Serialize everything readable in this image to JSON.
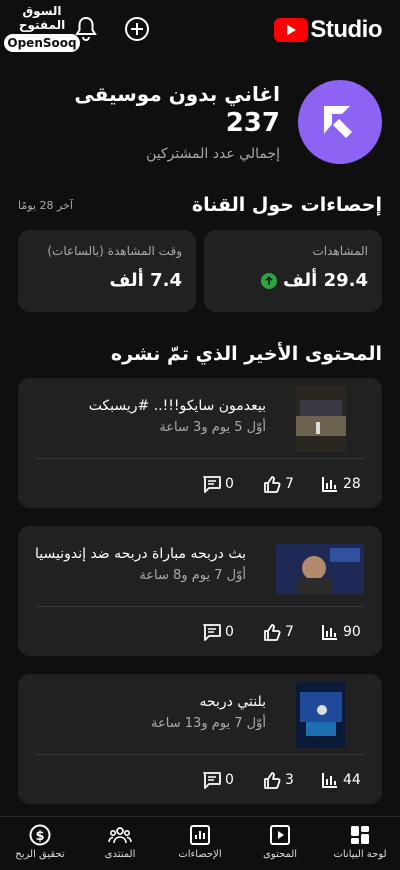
{
  "watermark": {
    "arabic": "السوق المفتوح",
    "brand": "OpenSooq"
  },
  "header": {
    "logo_text": "Studio",
    "logo_icon": "youtube-play-icon",
    "actions": [
      "bell-icon",
      "plus-circle-icon"
    ]
  },
  "channel": {
    "name": "اغاني بدون موسيقى",
    "subscribers": "237",
    "subscribers_label": "إجمالي عدد المشتركين",
    "avatar_color": "#8c63f2"
  },
  "stats": {
    "title": "إحصاءات حول القناة",
    "period": "آخر 28 يومًا",
    "views": {
      "label": "المشاهدات",
      "value": "29.4 ألف",
      "trend": "up"
    },
    "watch_time": {
      "label": "وقت المشاهدة (بالساعات)",
      "value": "7.4 ألف"
    }
  },
  "recent": {
    "title": "المحتوى الأخير الذي تمّ نشره",
    "videos": [
      {
        "title": "بيعدمون سايكو!!!.. #ريسبكت",
        "meta": "أوّل 5 يوم و3 ساعة",
        "views": "28",
        "likes": "7",
        "comments": "0"
      },
      {
        "title": "بث دربحه مباراة دربحه ضد إندونيسيا",
        "meta": "أوّل 7 يوم و8 ساعة",
        "views": "90",
        "likes": "7",
        "comments": "0"
      },
      {
        "title": "بلنتي دربحه",
        "meta": "أوّل 7 يوم و13 ساعة",
        "views": "44",
        "likes": "3",
        "comments": "0"
      }
    ]
  },
  "nav": {
    "items": [
      {
        "label": "لوحة البيانات",
        "icon": "dashboard-icon"
      },
      {
        "label": "المحتوى",
        "icon": "content-icon"
      },
      {
        "label": "الإحصاءات",
        "icon": "analytics-icon"
      },
      {
        "label": "المنتدى",
        "icon": "community-icon"
      },
      {
        "label": "تحقيق الربح",
        "icon": "earn-icon"
      }
    ]
  },
  "colors": {
    "background": "#0f0f0f",
    "card": "#212121",
    "accent": "#ff0000",
    "trend_up": "#2ba640"
  }
}
